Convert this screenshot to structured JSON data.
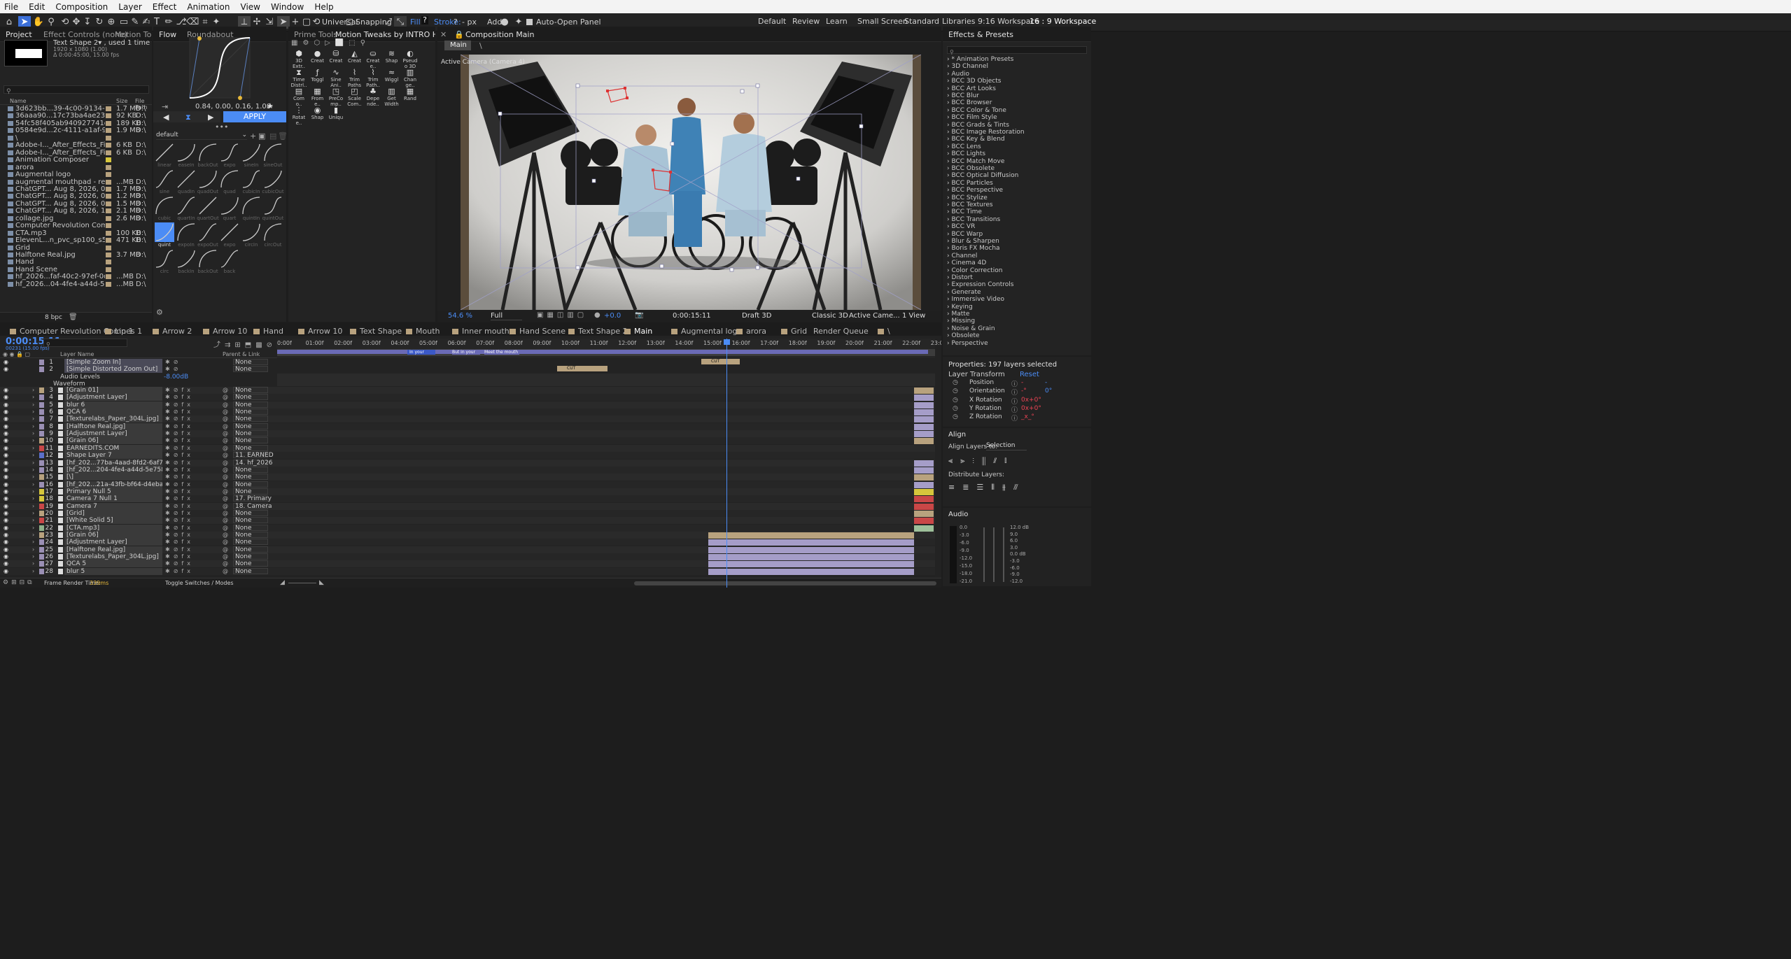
{
  "menu": [
    "File",
    "Edit",
    "Composition",
    "Layer",
    "Effect",
    "Animation",
    "View",
    "Window",
    "Help"
  ],
  "toolbar": {
    "universal": "Universal",
    "snapping": "Snapping",
    "fill_label": "Fill:",
    "fill_value": "?",
    "stroke_label": "Stroke:",
    "stroke_value": "?",
    "stroke_unit": "- px",
    "add_label": "Add:",
    "auto_open": "Auto-Open Panel",
    "workspaces": [
      "Default",
      "Review",
      "Learn",
      "Small Screen",
      "Standard",
      "Libraries",
      "9:16 Workspace",
      "16 : 9 Workspace"
    ]
  },
  "project": {
    "tabs": [
      "Project",
      "Effect Controls (none)",
      "Motion Tool"
    ],
    "thumb_name": "Text Shape 2▾ , used 1 time",
    "thumb_size": "1920 x 1080 (1.00)",
    "thumb_dur": "Δ 0:00:45:00, 15.00 fps",
    "cols": [
      "Name",
      "Size",
      "File Path"
    ],
    "rows": [
      {
        "name": "3d623bb...39-4c00-9134-62c2fa3f8f01.png",
        "size": "1.7 MB",
        "path": "D:\\",
        "label": "#b8a27e"
      },
      {
        "name": "36aaa90...17c73ba4ae239b872e053.jpg",
        "size": "92 KB",
        "path": "D:\\",
        "label": "#b8a27e"
      },
      {
        "name": "54fc58f405ab940927741deeS8a3a1ee.png",
        "size": "189 KB",
        "path": "D:\\",
        "label": "#b8a27e"
      },
      {
        "name": "0584e9d...2c-4111-a1af-9fd6305ac523.png",
        "size": "1.9 MB",
        "path": "D:\\",
        "label": "#b8a27e"
      },
      {
        "name": "\\",
        "size": "",
        "path": "",
        "label": "#b8a27e"
      },
      {
        "name": "Adobe-I..._After_Effects_Filetype_AEP.png",
        "size": "6 KB",
        "path": "D:\\",
        "label": "#b8a27e"
      },
      {
        "name": "Adobe-I..._After_Effects_Filetype_AEP.png",
        "size": "6 KB",
        "path": "D:\\",
        "label": "#b8a27e"
      },
      {
        "name": "Animation Composer",
        "size": "",
        "path": "",
        "label": "#d6c63c"
      },
      {
        "name": "arora",
        "size": "",
        "path": "",
        "label": "#b8a27e"
      },
      {
        "name": "Augmental logo",
        "size": "",
        "path": "",
        "label": "#b8a27e"
      },
      {
        "name": "augmental mouthpad - results.mp4",
        "size": "...MB",
        "path": "D:\\",
        "label": "#b8a27e"
      },
      {
        "name": "ChatGPT... Aug 8, 2026, 08_37_52 PM.png",
        "size": "1.7 MB",
        "path": "D:\\",
        "label": "#b8a27e"
      },
      {
        "name": "ChatGPT... Aug 8, 2026, 08_38_00 PM.png",
        "size": "1.2 MB",
        "path": "D:\\",
        "label": "#b8a27e"
      },
      {
        "name": "ChatGPT... Aug 8, 2026, 08_47_24 PM.png",
        "size": "1.5 MB",
        "path": "D:\\",
        "label": "#b8a27e"
      },
      {
        "name": "ChatGPT... Aug 8, 2026, 10_15_30 PM.png",
        "size": "2.1 MB",
        "path": "D:\\",
        "label": "#b8a27e"
      },
      {
        "name": "collage.jpg",
        "size": "2.6 MB",
        "path": "D:\\",
        "label": "#b8a27e"
      },
      {
        "name": "Computer Revolution Comp 1",
        "size": "",
        "path": "",
        "label": "#b8a27e"
      },
      {
        "name": "CTA.mp3",
        "size": "100 KB",
        "path": "D:\\",
        "label": "#b8a27e"
      },
      {
        "name": "ElevenL...n_pvc_sp100_s50_sb75_v3.mp3",
        "size": "471 KB",
        "path": "D:\\",
        "label": "#b8a27e"
      },
      {
        "name": "Grid",
        "size": "",
        "path": "",
        "label": "#b8a27e"
      },
      {
        "name": "Halftone Real.jpg",
        "size": "3.7 MB",
        "path": "D:\\",
        "label": "#b8a27e"
      },
      {
        "name": "Hand",
        "size": "",
        "path": "",
        "label": "#b8a27e"
      },
      {
        "name": "Hand Scene",
        "size": "",
        "path": "",
        "label": "#b8a27e"
      },
      {
        "name": "hf_2026...faf-40c2-97ef-0d39d5018461.png",
        "size": "...MB",
        "path": "D:\\",
        "label": "#b8a27e"
      },
      {
        "name": "hf_2026...04-4fe4-a44d-5e75876c3302.png",
        "size": "...MB",
        "path": "D:\\",
        "label": "#b8a27e"
      }
    ],
    "bpc": "8 bpc"
  },
  "flow": {
    "tabs": [
      "Flow",
      "Roundabout"
    ],
    "values": "0.84, 0.00, 0.16, 1.00",
    "apply": "APPLY",
    "preset": "default",
    "presets": [
      "linear",
      "easeIn",
      "backOut",
      "expo",
      "sineIn",
      "sineOut",
      "sine",
      "quadIn",
      "quadOut",
      "quad",
      "cubicIn",
      "cubicOut",
      "cubic",
      "quartIn",
      "quartOut",
      "quart",
      "quintIn",
      "quintOut",
      "quint",
      "expoIn",
      "expoOut",
      "expo",
      "circIn",
      "circOut",
      "circ",
      "backIn",
      "backOut",
      "back"
    ]
  },
  "motion": {
    "tabs": [
      "Prime Tools",
      "Motion Tweaks by INTRO HD"
    ],
    "tools": [
      "3D Extr..",
      "Creat",
      "Creat",
      "Creat",
      "Creat e..",
      "Shap",
      "Pseud o 3D",
      "Time Distrl..",
      "Toggl",
      "Sine Ani..",
      "Trim Paths",
      "Trim Path..",
      "Wiggl",
      "Chan ge..",
      "Com o..",
      "From e..",
      "PreCo mp..",
      "Scale Com..",
      "Depe nde..",
      "Get Width",
      "Rand",
      "Rotat e..",
      "Shap",
      "Uniqu"
    ]
  },
  "comp": {
    "title": "Composition Main",
    "tab": "Main",
    "camera": "Active Camera (Camera 4)",
    "zoom": "54.6 %",
    "quality": "Full",
    "exposure": "+0.0",
    "timecode": "0:00:15:11",
    "draft": "Draft 3D",
    "renderer": "Classic 3D",
    "view_camera": "Active Came...",
    "views": "1 View"
  },
  "timeline": {
    "tabs": [
      {
        "label": "Computer Revolution Comp 1",
        "color": "#b8a27e"
      },
      {
        "label": "Lines 1",
        "color": "#b8a27e"
      },
      {
        "label": "Arrow 2",
        "color": "#b8a27e"
      },
      {
        "label": "Arrow 10",
        "color": "#b8a27e"
      },
      {
        "label": "Hand",
        "color": "#b8a27e"
      },
      {
        "label": "Arrow 10",
        "color": "#b8a27e"
      },
      {
        "label": "Text Shape",
        "color": "#b8a27e"
      },
      {
        "label": "Mouth",
        "color": "#b8a27e"
      },
      {
        "label": "Inner mouth",
        "color": "#b8a27e"
      },
      {
        "label": "Hand Scene",
        "color": "#b8a27e"
      },
      {
        "label": "Text Shape 2",
        "color": "#b8a27e"
      },
      {
        "label": "Main",
        "color": "#b8a27e"
      },
      {
        "label": "Augmental logo",
        "color": "#b8a27e"
      },
      {
        "label": "arora",
        "color": "#b8a27e"
      },
      {
        "label": "Grid",
        "color": "#b8a27e"
      },
      {
        "label": "Render Queue",
        "color": ""
      },
      {
        "label": "\\",
        "color": "#b8a27e"
      }
    ],
    "timecode": "0:00:15:11",
    "frame_info": "00231 (15.00 fps)",
    "col_layer": "Layer Name",
    "col_parent": "Parent & Link",
    "ruler": [
      "0:00f",
      "01:00f",
      "02:00f",
      "03:00f",
      "04:00f",
      "05:00f",
      "06:00f",
      "07:00f",
      "08:00f",
      "09:00f",
      "10:00f",
      "11:00f",
      "12:00f",
      "13:00f",
      "14:00f",
      "15:00f",
      "16:00f",
      "17:00f",
      "18:00f",
      "19:00f",
      "20:00f",
      "21:00f",
      "22:00f",
      "23:0"
    ],
    "audio_levels": "Audio Levels",
    "audio_value": "-8.00dB",
    "waveform": "Waveform",
    "markers": [
      "In your Hand",
      "But in your ha...",
      "Meet the mouth",
      "CUT",
      "CUT"
    ],
    "layers": [
      {
        "n": "1",
        "name": "[Simple Zoom In]",
        "color": "#9a8fb4",
        "parent": "None",
        "track": "#b8a27e"
      },
      {
        "n": "2",
        "name": "[Simple Distorted Zoom Out]",
        "color": "#9a8fb4",
        "parent": "None",
        "track": "#b8a27e"
      },
      {
        "n": "3",
        "name": "[Grain 01]",
        "color": "#b8a27e",
        "parent": "None",
        "track": "#b8a27e"
      },
      {
        "n": "4",
        "name": "[Adjustment Layer]",
        "color": "#9a8fb4",
        "parent": "None",
        "track": "#a59dc8"
      },
      {
        "n": "5",
        "name": "blur 6",
        "color": "#9a8fb4",
        "parent": "None",
        "track": "#a59dc8"
      },
      {
        "n": "6",
        "name": "QCA 6",
        "color": "#9a8fb4",
        "parent": "None",
        "track": "#a59dc8"
      },
      {
        "n": "7",
        "name": "[Texturelabs_Paper_304L.jpg]",
        "color": "#9a8fb4",
        "parent": "None",
        "track": "#a59dc8"
      },
      {
        "n": "8",
        "name": "[Halftone Real.jpg]",
        "color": "#9a8fb4",
        "parent": "None",
        "track": "#a59dc8"
      },
      {
        "n": "9",
        "name": "[Adjustment Layer]",
        "color": "#9a8fb4",
        "parent": "None",
        "track": "#a59dc8"
      },
      {
        "n": "10",
        "name": "[Grain 06]",
        "color": "#b8a27e",
        "parent": "None",
        "track": "#b8a27e"
      },
      {
        "n": "11",
        "name": "EARNEDITS.COM",
        "color": "#c94747",
        "parent": "None",
        "track": ""
      },
      {
        "n": "12",
        "name": "Shape Layer 7",
        "color": "#5b6fc9",
        "parent": "11. EARNED",
        "track": ""
      },
      {
        "n": "13",
        "name": "[hf_202...77ba-4aad-8fd2-6af79135e2f8.png]",
        "color": "#9a8fb4",
        "parent": "14. hf_2026",
        "track": "#a59dc8"
      },
      {
        "n": "14",
        "name": "[hf_202...204-4fe4-a44d-5e75876c3302.png]",
        "color": "#9a8fb4",
        "parent": "None",
        "track": "#a59dc8"
      },
      {
        "n": "15",
        "name": "[\\]",
        "color": "#b8a27e",
        "parent": "None",
        "track": "#b8a27e"
      },
      {
        "n": "16",
        "name": "[hf_202...21a-43fb-bf64-d4eba78ac845.png]",
        "color": "#9a8fb4",
        "parent": "None",
        "track": "#a59dc8"
      },
      {
        "n": "17",
        "name": "Primary Null 5",
        "color": "#d6c63c",
        "parent": "None",
        "track": "#d6c63c"
      },
      {
        "n": "18",
        "name": "Camera 7 Null 1",
        "color": "#d6c63c",
        "parent": "17. Primary",
        "track": "#c94747"
      },
      {
        "n": "19",
        "name": "Camera 7",
        "color": "#c94747",
        "parent": "18. Camera",
        "track": "#c94747"
      },
      {
        "n": "20",
        "name": "[Grid]",
        "color": "#b8a27e",
        "parent": "None",
        "track": "#b8a27e"
      },
      {
        "n": "21",
        "name": "[White Solid 5]",
        "color": "#c94747",
        "parent": "None",
        "track": "#c94747"
      },
      {
        "n": "22",
        "name": "[CTA.mp3]",
        "color": "#8fb08a",
        "parent": "None",
        "track": "#9ec09a"
      },
      {
        "n": "23",
        "name": "[Grain 06]",
        "color": "#b8a27e",
        "parent": "None",
        "track": "#b8a27e"
      },
      {
        "n": "24",
        "name": "[Adjustment Layer]",
        "color": "#9a8fb4",
        "parent": "None",
        "track": "#a59dc8"
      },
      {
        "n": "25",
        "name": "[Halftone Real.jpg]",
        "color": "#9a8fb4",
        "parent": "None",
        "track": "#a59dc8"
      },
      {
        "n": "26",
        "name": "[Texturelabs_Paper_304L.jpg]",
        "color": "#9a8fb4",
        "parent": "None",
        "track": "#a59dc8"
      },
      {
        "n": "27",
        "name": "QCA 5",
        "color": "#9a8fb4",
        "parent": "None",
        "track": "#a59dc8"
      },
      {
        "n": "28",
        "name": "blur 5",
        "color": "#9a8fb4",
        "parent": "None",
        "track": "#a59dc8"
      }
    ],
    "render_time_label": "Frame Render Time:",
    "render_time": "339ms",
    "toggle": "Toggle Switches / Modes"
  },
  "effects": {
    "title": "Effects & Presets",
    "items": [
      "* Animation Presets",
      "3D Channel",
      "Audio",
      "BCC 3D Objects",
      "BCC Art Looks",
      "BCC Blur",
      "BCC Browser",
      "BCC Color & Tone",
      "BCC Film Style",
      "BCC Grads & Tints",
      "BCC Image Restoration",
      "BCC Key & Blend",
      "BCC Lens",
      "BCC Lights",
      "BCC Match Move",
      "BCC Obsolete",
      "BCC Optical Diffusion",
      "BCC Particles",
      "BCC Perspective",
      "BCC Stylize",
      "BCC Textures",
      "BCC Time",
      "BCC Transitions",
      "BCC VR",
      "BCC Warp",
      "Blur & Sharpen",
      "Boris FX Mocha",
      "Channel",
      "Cinema 4D",
      "Color Correction",
      "Distort",
      "Expression Controls",
      "Generate",
      "Immersive Video",
      "Keying",
      "Matte",
      "Missing",
      "Noise & Grain",
      "Obsolete",
      "Perspective"
    ]
  },
  "properties": {
    "title": "Properties: 197 layers selected",
    "transform": "Layer Transform",
    "reset": "Reset",
    "rows": [
      {
        "label": "Position",
        "v1": "-",
        "v2": "-"
      },
      {
        "label": "Orientation",
        "v1": "-°",
        "v2": "0°"
      },
      {
        "label": "X Rotation",
        "v1": "0x+0°",
        "v2": ""
      },
      {
        "label": "Y Rotation",
        "v1": "0x+0°",
        "v2": ""
      },
      {
        "label": "Z Rotation",
        "v1": "_x_°",
        "v2": ""
      }
    ]
  },
  "align": {
    "title": "Align",
    "align_to_label": "Align Layers to:",
    "align_to": "Selection",
    "distribute": "Distribute Layers:"
  },
  "audio": {
    "title": "Audio",
    "left": [
      "0.0",
      "-3.0",
      "-6.0",
      "-9.0",
      "-12.0",
      "-15.0",
      "-18.0",
      "-21.0"
    ],
    "right": [
      "12.0 dB",
      "9.0",
      "6.0",
      "3.0",
      "0.0 dB",
      "-3.0",
      "-6.0",
      "-9.0",
      "-12.0"
    ]
  }
}
